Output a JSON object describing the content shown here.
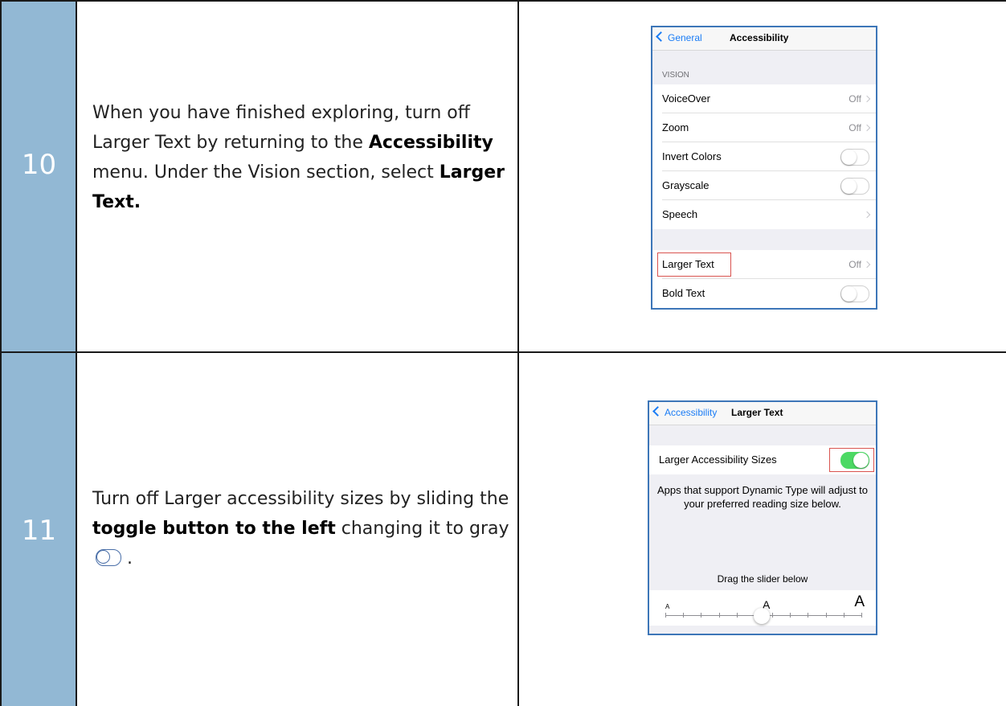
{
  "steps": [
    {
      "number": "10",
      "text_parts": [
        "When you have finished exploring, turn off Larger Text by returning to the ",
        "Accessibility",
        " menu.  Under the Vision section, select ",
        "Larger Text."
      ],
      "screenshot": {
        "back_label": "General",
        "title": "Accessibility",
        "section_header": "VISION",
        "vision_items": [
          {
            "label": "VoiceOver",
            "value": "Off",
            "type": "disclosure"
          },
          {
            "label": "Zoom",
            "value": "Off",
            "type": "disclosure"
          },
          {
            "label": "Invert Colors",
            "type": "toggle",
            "on": false
          },
          {
            "label": "Grayscale",
            "type": "toggle",
            "on": false
          },
          {
            "label": "Speech",
            "value": "",
            "type": "disclosure"
          }
        ],
        "text_items": [
          {
            "label": "Larger Text",
            "value": "Off",
            "type": "disclosure",
            "highlighted": true
          },
          {
            "label": "Bold Text",
            "type": "toggle",
            "on": false
          }
        ]
      }
    },
    {
      "number": "11",
      "text_parts": [
        "Turn off Larger accessibility sizes by sliding the ",
        "toggle button to the left",
        " changing it to gray",
        " ."
      ],
      "screenshot": {
        "back_label": "Accessibility",
        "title": "Larger Text",
        "toggle_label": "Larger Accessibility Sizes",
        "toggle_on": true,
        "description": "Apps that support Dynamic Type will adjust to your preferred reading size below.",
        "slider_hint": "Drag the slider below",
        "slider_small_label": "A",
        "slider_mid_label": "A",
        "slider_large_label": "A",
        "slider_position_fraction": 0.5
      }
    }
  ],
  "colors": {
    "number_column": "#92b8d4",
    "ios_blue": "#1a7cf5",
    "toggle_on": "#4cd964",
    "screenshot_border": "#3d76b8",
    "highlight_box": "#d9534f"
  }
}
